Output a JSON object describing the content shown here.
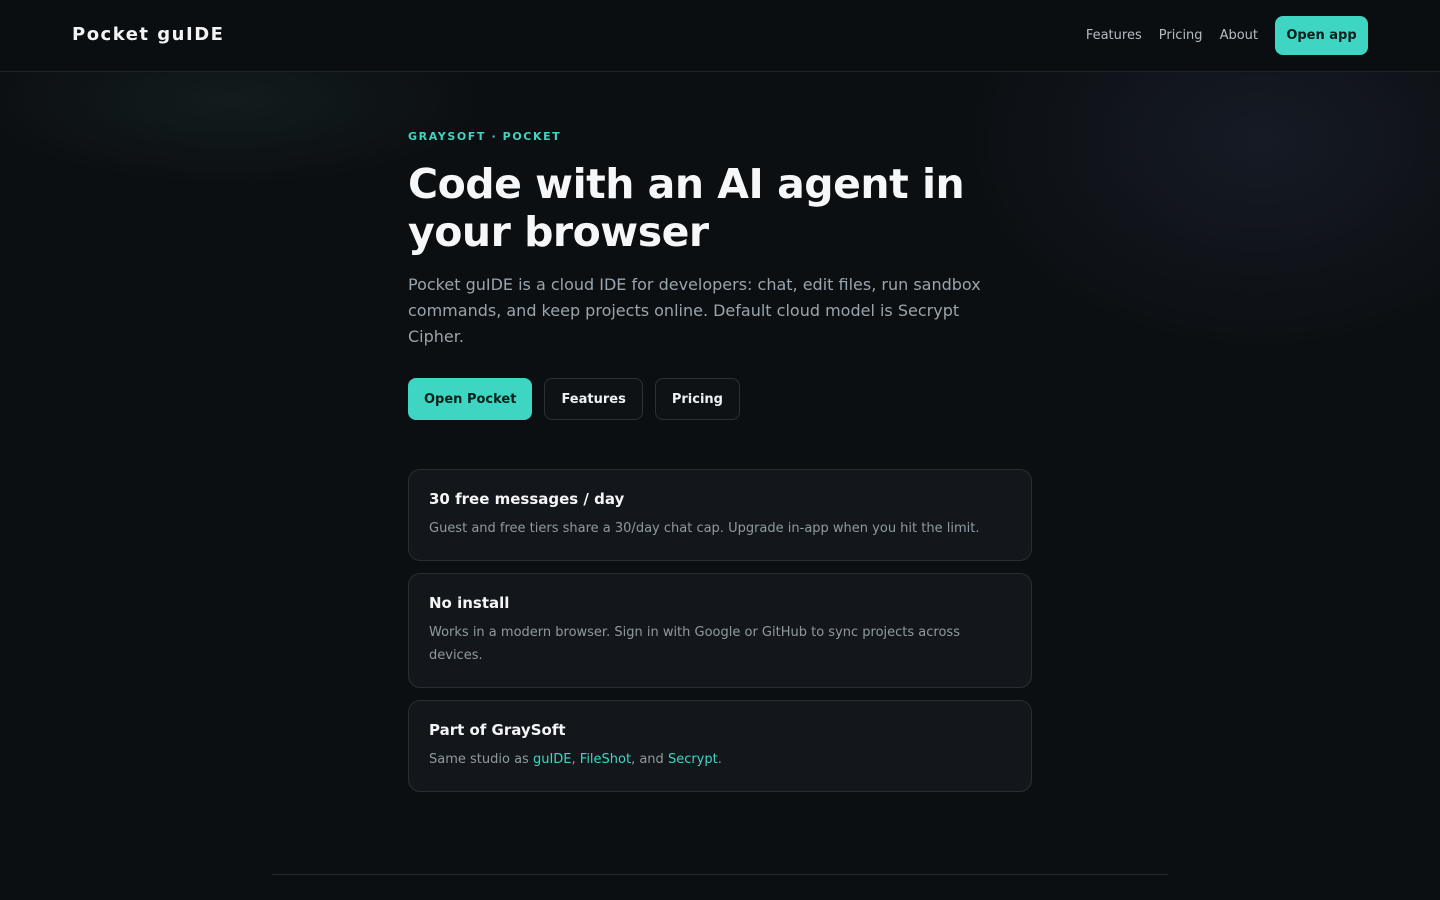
{
  "header": {
    "brand": "Pocket guIDE",
    "nav": [
      "Features",
      "Pricing",
      "About"
    ],
    "cta": "Open app"
  },
  "hero": {
    "eyebrow": "GRAYSOFT · POCKET",
    "headline": "Code with an AI agent in your browser",
    "lead": "Pocket guIDE is a cloud IDE for developers: chat, edit files, run sandbox commands, and keep projects online. Default cloud model is Secrypt Cipher.",
    "buttons": {
      "primary": "Open Pocket",
      "features": "Features",
      "pricing": "Pricing"
    }
  },
  "cards": [
    {
      "title": "30 free messages / day",
      "body": "Guest and free tiers share a 30/day chat cap. Upgrade in-app when you hit the limit."
    },
    {
      "title": "No install",
      "body": "Works in a modern browser. Sign in with Google or GitHub to sync projects across devices."
    },
    {
      "title": "Part of GraySoft",
      "body_prefix": "Same studio as ",
      "links": [
        "guIDE",
        "FileShot",
        "Secrypt"
      ],
      "sep1": ", ",
      "sep2": ", and ",
      "body_suffix": "."
    }
  ],
  "colors": {
    "accent": "#3ed6c2",
    "background": "#0c0f12",
    "card": "#13171b"
  }
}
